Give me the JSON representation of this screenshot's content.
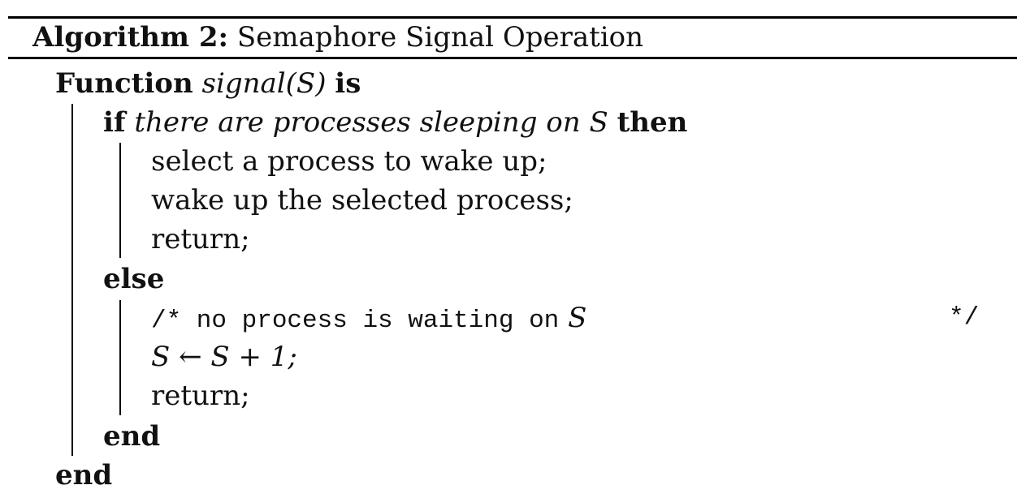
{
  "header": {
    "label": "Algorithm 2:",
    "title": "Semaphore Signal Operation"
  },
  "code": {
    "function_kw": "Function",
    "function_name": "signal(S)",
    "is_kw": "is",
    "if_kw": "if",
    "if_condition": "there are processes sleeping on S",
    "then_kw": "then",
    "then_lines": [
      "select a process to wake up;",
      "wake up the selected process;",
      "return;"
    ],
    "else_kw": "else",
    "comment_open": "/* no process is waiting on",
    "comment_var": "S",
    "comment_close": "*/",
    "assign": "S ← S + 1;",
    "else_return": "return;",
    "end_inner": "end",
    "end_outer": "end"
  }
}
